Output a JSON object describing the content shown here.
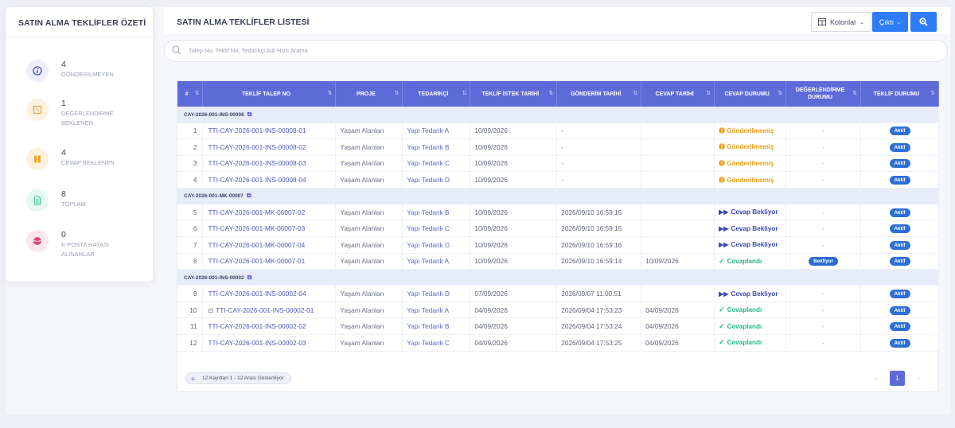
{
  "summary": {
    "title": "SATIN ALMA TEKLİFLER ÖZETİ",
    "items": [
      {
        "count": "4",
        "label": "GÖNDERİLMEYEN",
        "icon": "info-icon",
        "color": "#3a4cc0",
        "bg": "#eceffa"
      },
      {
        "count": "1",
        "label": "DEĞERLENDİRME BEKLENEN",
        "icon": "clipboard-icon",
        "color": "#e3a54a",
        "bg": "#fdf1e1"
      },
      {
        "count": "4",
        "label": "CEVAP BEKLENEN",
        "icon": "pause-icon",
        "color": "#f0a01a",
        "bg": "#fdf1dc"
      },
      {
        "count": "8",
        "label": "TOPLAM",
        "icon": "document-icon",
        "color": "#43c3a0",
        "bg": "#e4f7f1"
      },
      {
        "count": "0",
        "label": "E-POSTA HATASI ALINANLAR",
        "icon": "ball-icon",
        "color": "#e0487a",
        "bg": "#fce6ee"
      }
    ]
  },
  "header": {
    "title": "SATIN ALMA TEKLİFLER LİSTESİ",
    "columns_button": "Kolonlar",
    "output_button": "Çıktı"
  },
  "search": {
    "placeholder": "Talep No, Teklif No, Tedarikçi Adı Hızlı Arama"
  },
  "table": {
    "headers": [
      "#",
      "TEKLİF TALEP NO",
      "PROJE",
      "TEDARİKÇİ",
      "TEKLİF İSTEK TARİHİ",
      "GÖNDERİM TARİHİ",
      "CEVAP TARİHİ",
      "CEVAP DURUMU",
      "DEĞERLENDİRME DURUMU",
      "TEKLİF DURUMU"
    ],
    "groups": [
      {
        "name": "CAY-2026-001-INS-00008",
        "rows": [
          {
            "no": "1",
            "talep": "TTI-CAY-2026-001-INS-00008-01",
            "proje": "Yaşam Alanları",
            "tedarikci": "Yapı Tedarik A",
            "istek": "10/09/2026",
            "gonderim": "-",
            "cevap": "",
            "durum": "Gönderilmemiş",
            "durum_type": "orange",
            "deg": "-",
            "teklif": "Aktif"
          },
          {
            "no": "2",
            "talep": "TTI-CAY-2026-001-INS-00008-02",
            "proje": "Yaşam Alanları",
            "tedarikci": "Yapı Tedarik B",
            "istek": "10/09/2026",
            "gonderim": "-",
            "cevap": "",
            "durum": "Gönderilmemiş",
            "durum_type": "orange",
            "deg": "-",
            "teklif": "Aktif"
          },
          {
            "no": "3",
            "talep": "TTI-CAY-2026-001-INS-00008-03",
            "proje": "Yaşam Alanları",
            "tedarikci": "Yapı Tedarik C",
            "istek": "10/09/2026",
            "gonderim": "-",
            "cevap": "",
            "durum": "Gönderilmemiş",
            "durum_type": "orange",
            "deg": "-",
            "teklif": "Aktif"
          },
          {
            "no": "4",
            "talep": "TTI-CAY-2026-001-INS-00008-04",
            "proje": "Yaşam Alanları",
            "tedarikci": "Yapı Tedarik D",
            "istek": "10/09/2026",
            "gonderim": "-",
            "cevap": "",
            "durum": "Gönderilmemiş",
            "durum_type": "orange",
            "deg": "-",
            "teklif": "Aktif"
          }
        ]
      },
      {
        "name": "CAY-2026-001-MK-00007",
        "rows": [
          {
            "no": "5",
            "talep": "TTI-CAY-2026-001-MK-00007-02",
            "proje": "Yaşam Alanları",
            "tedarikci": "Yapı Tedarik B",
            "istek": "10/09/2026",
            "gonderim": "2026/09/10 16:59:15",
            "cevap": "",
            "durum": "Cevap Bekliyor",
            "durum_type": "blue",
            "deg": "-",
            "teklif": "Aktif"
          },
          {
            "no": "6",
            "talep": "TTI-CAY-2026-001-MK-00007-03",
            "proje": "Yaşam Alanları",
            "tedarikci": "Yapı Tedarik C",
            "istek": "10/09/2026",
            "gonderim": "2026/09/10 16:59:15",
            "cevap": "",
            "durum": "Cevap Bekliyor",
            "durum_type": "blue",
            "deg": "-",
            "teklif": "Aktif"
          },
          {
            "no": "7",
            "talep": "TTI-CAY-2026-001-MK-00007-04",
            "proje": "Yaşam Alanları",
            "tedarikci": "Yapı Tedarik D",
            "istek": "10/09/2026",
            "gonderim": "2026/09/10 16:59:16",
            "cevap": "",
            "durum": "Cevap Bekliyor",
            "durum_type": "blue",
            "deg": "-",
            "teklif": "Aktif"
          },
          {
            "no": "8",
            "talep": "TTI-CAY-2026-001-MK-00007-01",
            "proje": "Yaşam Alanları",
            "tedarikci": "Yapı Tedarik A",
            "istek": "10/09/2026",
            "gonderim": "2026/09/10 16:59:14",
            "cevap": "10/09/2026",
            "durum": "Cevaplandı",
            "durum_type": "green",
            "deg": "Bekliyor",
            "teklif": "Aktif"
          }
        ]
      },
      {
        "name": "CAY-2026-001-INS-00002",
        "rows": [
          {
            "no": "9",
            "talep": "TTI-CAY-2026-001-INS-00002-04",
            "proje": "Yaşam Alanları",
            "tedarikci": "Yapı Tedarik D",
            "istek": "07/09/2026",
            "gonderim": "2026/09/07 11:00:51",
            "cevap": "",
            "durum": "Cevap Bekliyor",
            "durum_type": "blue",
            "deg": "-",
            "teklif": "Aktif"
          },
          {
            "no": "10",
            "talep": "TTI-CAY-2026-001-INS-00002-01",
            "proje": "Yaşam Alanları",
            "tedarikci": "Yapı Tedarik A",
            "istek": "04/09/2026",
            "gonderim": "2026/09/04 17:53:23",
            "cevap": "04/09/2026",
            "durum": "Cevaplandı",
            "durum_type": "green",
            "deg": "-",
            "teklif": "Aktif",
            "lock": true
          },
          {
            "no": "11",
            "talep": "TTI-CAY-2026-001-INS-00002-02",
            "proje": "Yaşam Alanları",
            "tedarikci": "Yapı Tedarik B",
            "istek": "04/09/2026",
            "gonderim": "2026/09/04 17:53:24",
            "cevap": "04/09/2026",
            "durum": "Cevaplandı",
            "durum_type": "green",
            "deg": "-",
            "teklif": "Aktif"
          },
          {
            "no": "12",
            "talep": "TTI-CAY-2026-001-INS-00002-03",
            "proje": "Yaşam Alanları",
            "tedarikci": "Yapı Tedarik C",
            "istek": "04/09/2026",
            "gonderim": "2026/09/04 17:53:25",
            "cevap": "04/09/2026",
            "durum": "Cevaplandı",
            "durum_type": "green",
            "deg": "-",
            "teklif": "Aktif"
          }
        ]
      }
    ]
  },
  "footer": {
    "records_text": "12 Kayıttan 1 - 12 Arası Gösteriliyor",
    "current_page": "1",
    "prev": "‹",
    "next": "›"
  },
  "colors": {
    "accent": "#2d7cf6",
    "header_bg": "#5c6bd8",
    "group_bg": "#e8ebf9"
  }
}
